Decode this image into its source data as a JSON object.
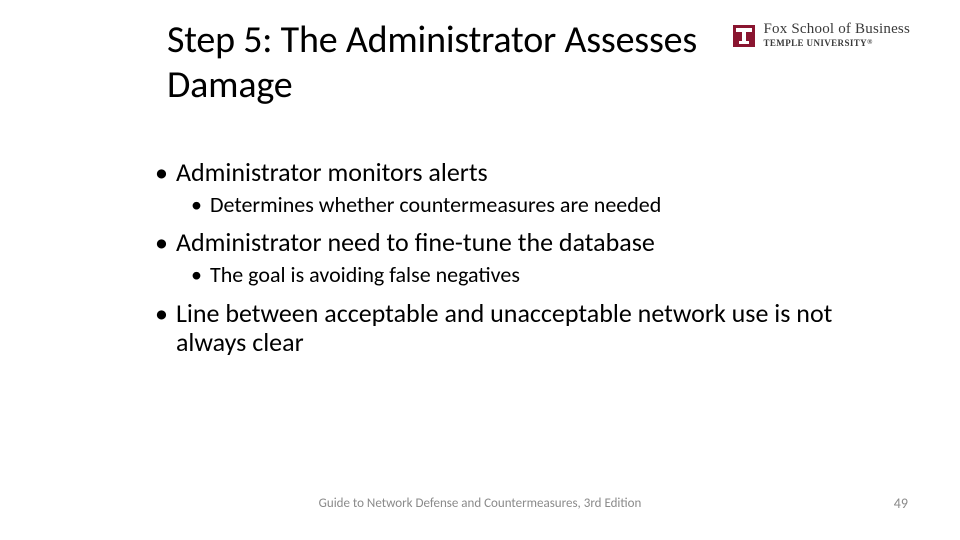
{
  "title": "Step 5: The Administrator Assesses Damage",
  "logo": {
    "line1": "Fox School of Business",
    "line2": "TEMPLE UNIVERSITY",
    "registered": "®",
    "mark_color": "#8a1530"
  },
  "bullets": {
    "l1": [
      {
        "text": "Administrator monitors alerts",
        "sub": [
          "Determines whether countermeasures are needed"
        ]
      },
      {
        "text": "Administrator need to fine-tune the database",
        "sub": [
          "The goal is avoiding false negatives"
        ]
      },
      {
        "text": "Line between acceptable and unacceptable network use is not always clear",
        "sub": []
      }
    ]
  },
  "footer": {
    "center": "Guide to Network Defense and Countermeasures, 3rd Edition",
    "page": "49"
  }
}
